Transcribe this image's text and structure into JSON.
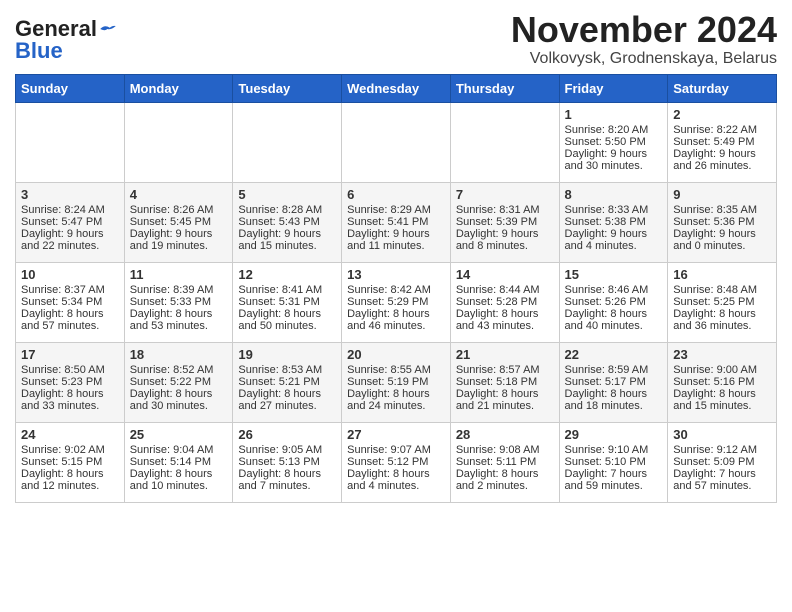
{
  "logo": {
    "line1": "General",
    "line2": "Blue"
  },
  "title": "November 2024",
  "subtitle": "Volkovysk, Grodnenskaya, Belarus",
  "headers": [
    "Sunday",
    "Monday",
    "Tuesday",
    "Wednesday",
    "Thursday",
    "Friday",
    "Saturday"
  ],
  "weeks": [
    [
      {
        "day": "",
        "info": ""
      },
      {
        "day": "",
        "info": ""
      },
      {
        "day": "",
        "info": ""
      },
      {
        "day": "",
        "info": ""
      },
      {
        "day": "",
        "info": ""
      },
      {
        "day": "1",
        "info": "Sunrise: 8:20 AM\nSunset: 5:50 PM\nDaylight: 9 hours\nand 30 minutes."
      },
      {
        "day": "2",
        "info": "Sunrise: 8:22 AM\nSunset: 5:49 PM\nDaylight: 9 hours\nand 26 minutes."
      }
    ],
    [
      {
        "day": "3",
        "info": "Sunrise: 8:24 AM\nSunset: 5:47 PM\nDaylight: 9 hours\nand 22 minutes."
      },
      {
        "day": "4",
        "info": "Sunrise: 8:26 AM\nSunset: 5:45 PM\nDaylight: 9 hours\nand 19 minutes."
      },
      {
        "day": "5",
        "info": "Sunrise: 8:28 AM\nSunset: 5:43 PM\nDaylight: 9 hours\nand 15 minutes."
      },
      {
        "day": "6",
        "info": "Sunrise: 8:29 AM\nSunset: 5:41 PM\nDaylight: 9 hours\nand 11 minutes."
      },
      {
        "day": "7",
        "info": "Sunrise: 8:31 AM\nSunset: 5:39 PM\nDaylight: 9 hours\nand 8 minutes."
      },
      {
        "day": "8",
        "info": "Sunrise: 8:33 AM\nSunset: 5:38 PM\nDaylight: 9 hours\nand 4 minutes."
      },
      {
        "day": "9",
        "info": "Sunrise: 8:35 AM\nSunset: 5:36 PM\nDaylight: 9 hours\nand 0 minutes."
      }
    ],
    [
      {
        "day": "10",
        "info": "Sunrise: 8:37 AM\nSunset: 5:34 PM\nDaylight: 8 hours\nand 57 minutes."
      },
      {
        "day": "11",
        "info": "Sunrise: 8:39 AM\nSunset: 5:33 PM\nDaylight: 8 hours\nand 53 minutes."
      },
      {
        "day": "12",
        "info": "Sunrise: 8:41 AM\nSunset: 5:31 PM\nDaylight: 8 hours\nand 50 minutes."
      },
      {
        "day": "13",
        "info": "Sunrise: 8:42 AM\nSunset: 5:29 PM\nDaylight: 8 hours\nand 46 minutes."
      },
      {
        "day": "14",
        "info": "Sunrise: 8:44 AM\nSunset: 5:28 PM\nDaylight: 8 hours\nand 43 minutes."
      },
      {
        "day": "15",
        "info": "Sunrise: 8:46 AM\nSunset: 5:26 PM\nDaylight: 8 hours\nand 40 minutes."
      },
      {
        "day": "16",
        "info": "Sunrise: 8:48 AM\nSunset: 5:25 PM\nDaylight: 8 hours\nand 36 minutes."
      }
    ],
    [
      {
        "day": "17",
        "info": "Sunrise: 8:50 AM\nSunset: 5:23 PM\nDaylight: 8 hours\nand 33 minutes."
      },
      {
        "day": "18",
        "info": "Sunrise: 8:52 AM\nSunset: 5:22 PM\nDaylight: 8 hours\nand 30 minutes."
      },
      {
        "day": "19",
        "info": "Sunrise: 8:53 AM\nSunset: 5:21 PM\nDaylight: 8 hours\nand 27 minutes."
      },
      {
        "day": "20",
        "info": "Sunrise: 8:55 AM\nSunset: 5:19 PM\nDaylight: 8 hours\nand 24 minutes."
      },
      {
        "day": "21",
        "info": "Sunrise: 8:57 AM\nSunset: 5:18 PM\nDaylight: 8 hours\nand 21 minutes."
      },
      {
        "day": "22",
        "info": "Sunrise: 8:59 AM\nSunset: 5:17 PM\nDaylight: 8 hours\nand 18 minutes."
      },
      {
        "day": "23",
        "info": "Sunrise: 9:00 AM\nSunset: 5:16 PM\nDaylight: 8 hours\nand 15 minutes."
      }
    ],
    [
      {
        "day": "24",
        "info": "Sunrise: 9:02 AM\nSunset: 5:15 PM\nDaylight: 8 hours\nand 12 minutes."
      },
      {
        "day": "25",
        "info": "Sunrise: 9:04 AM\nSunset: 5:14 PM\nDaylight: 8 hours\nand 10 minutes."
      },
      {
        "day": "26",
        "info": "Sunrise: 9:05 AM\nSunset: 5:13 PM\nDaylight: 8 hours\nand 7 minutes."
      },
      {
        "day": "27",
        "info": "Sunrise: 9:07 AM\nSunset: 5:12 PM\nDaylight: 8 hours\nand 4 minutes."
      },
      {
        "day": "28",
        "info": "Sunrise: 9:08 AM\nSunset: 5:11 PM\nDaylight: 8 hours\nand 2 minutes."
      },
      {
        "day": "29",
        "info": "Sunrise: 9:10 AM\nSunset: 5:10 PM\nDaylight: 7 hours\nand 59 minutes."
      },
      {
        "day": "30",
        "info": "Sunrise: 9:12 AM\nSunset: 5:09 PM\nDaylight: 7 hours\nand 57 minutes."
      }
    ]
  ]
}
